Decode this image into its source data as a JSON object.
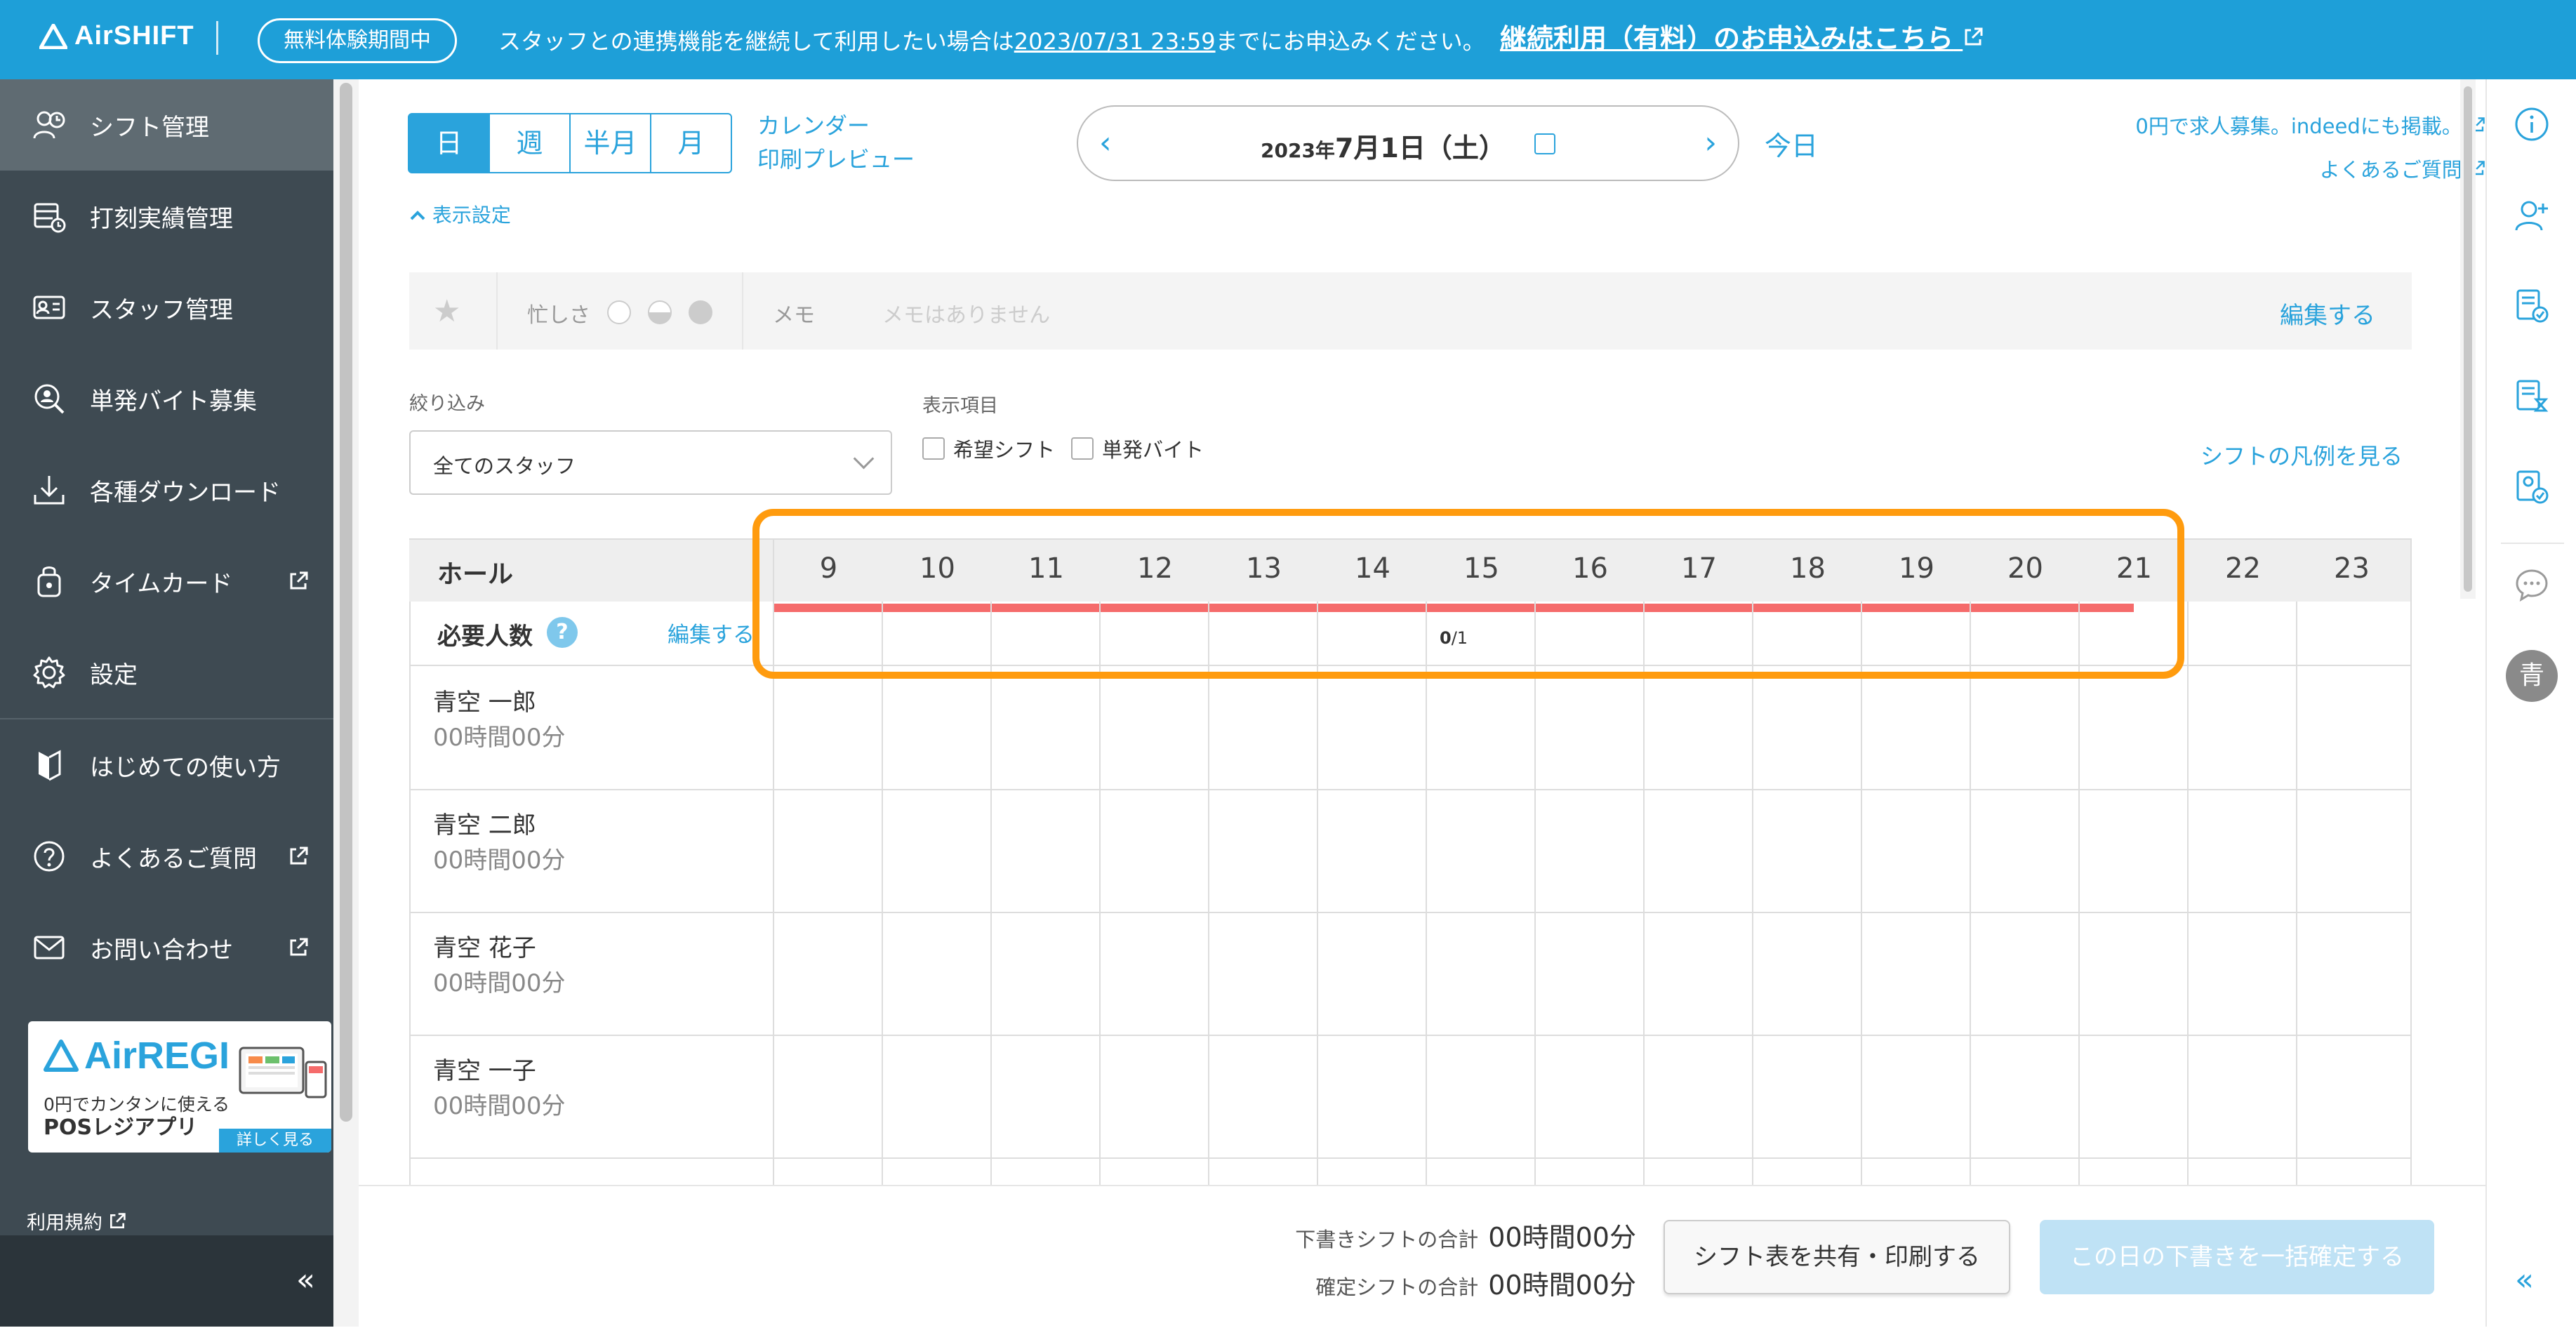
{
  "topbar": {
    "logo": "AirSHIFT",
    "trial_badge": "無料体験期間中",
    "message_pre": "スタッフとの連携機能を継続して利用したい場合は",
    "deadline": "2023/07/31 23:59",
    "message_post": "までにお申込みください。",
    "cta": "継続利用（有料）のお申込みはこちら"
  },
  "sidebar": {
    "items": [
      {
        "label": "シフト管理",
        "icon": "shift-icon"
      },
      {
        "label": "打刻実績管理",
        "icon": "timestamp-icon"
      },
      {
        "label": "スタッフ管理",
        "icon": "staff-card-icon"
      },
      {
        "label": "単発バイト募集",
        "icon": "search-person-icon"
      },
      {
        "label": "各種ダウンロード",
        "icon": "download-icon"
      },
      {
        "label": "タイムカード",
        "icon": "timecard-icon"
      },
      {
        "label": "設定",
        "icon": "gear-icon"
      },
      {
        "label": "はじめての使い方",
        "icon": "beginner-icon"
      },
      {
        "label": "よくあるご質問",
        "icon": "question-icon"
      },
      {
        "label": "お問い合わせ",
        "icon": "mail-icon"
      }
    ],
    "banner": {
      "brand": "AirREGI",
      "line1": "0円でカンタンに使える",
      "line2": "POSレジアプリ",
      "more": "詳しく見る"
    },
    "terms": "利用規約",
    "collapse": "«"
  },
  "toolbar": {
    "view_tabs": [
      "日",
      "週",
      "半月",
      "月"
    ],
    "active_tab": "日",
    "calendar_link": "カレンダー",
    "print_preview": "印刷プレビュー",
    "date_year": "2023年",
    "date_main": "7月1日（土）",
    "prev": "‹",
    "next": "›",
    "today": "今日",
    "job_link": "0円で求人募集。indeedにも掲載。",
    "faq_link": "よくあるご質問",
    "display_settings": "表示設定"
  },
  "memo": {
    "busy_label": "忙しさ",
    "memo_label": "メモ",
    "memo_value": "メモはありません",
    "edit": "編集する"
  },
  "filters": {
    "filter_label": "絞り込み",
    "filter_value": "全てのスタッフ",
    "display_label": "表示項目",
    "checkbox_hope": "希望シフト",
    "checkbox_single": "単発バイト",
    "legend_link": "シフトの凡例を見る"
  },
  "grid": {
    "area": "ホール",
    "hours": [
      "9",
      "10",
      "11",
      "12",
      "13",
      "14",
      "15",
      "16",
      "17",
      "18",
      "19",
      "20",
      "21",
      "22",
      "23"
    ],
    "required_label": "必要人数",
    "help": "?",
    "required_edit": "編集する",
    "required_assigned": "0",
    "required_total": "/1",
    "staff": [
      {
        "name": "青空 一郎",
        "hours": "00時間00分"
      },
      {
        "name": "青空 二郎",
        "hours": "00時間00分"
      },
      {
        "name": "青空 花子",
        "hours": "00時間00分"
      },
      {
        "name": "青空 一子",
        "hours": "00時間00分"
      }
    ]
  },
  "footer": {
    "draft_label": "下書きシフトの合計",
    "draft_value": "00時間00分",
    "confirmed_label": "確定シフトの合計",
    "confirmed_value": "00時間00分",
    "share_button": "シフト表を共有・印刷する",
    "confirm_button": "この日の下書きを一括確定する"
  },
  "rightbar": {
    "avatar": "青",
    "collapse": "«"
  },
  "colors": {
    "brand": "#1e9fd8",
    "accent": "#2aa3dc",
    "required_bar": "#f56b6b",
    "highlight": "#ff9b0e",
    "sidebar": "#3e4a52"
  }
}
